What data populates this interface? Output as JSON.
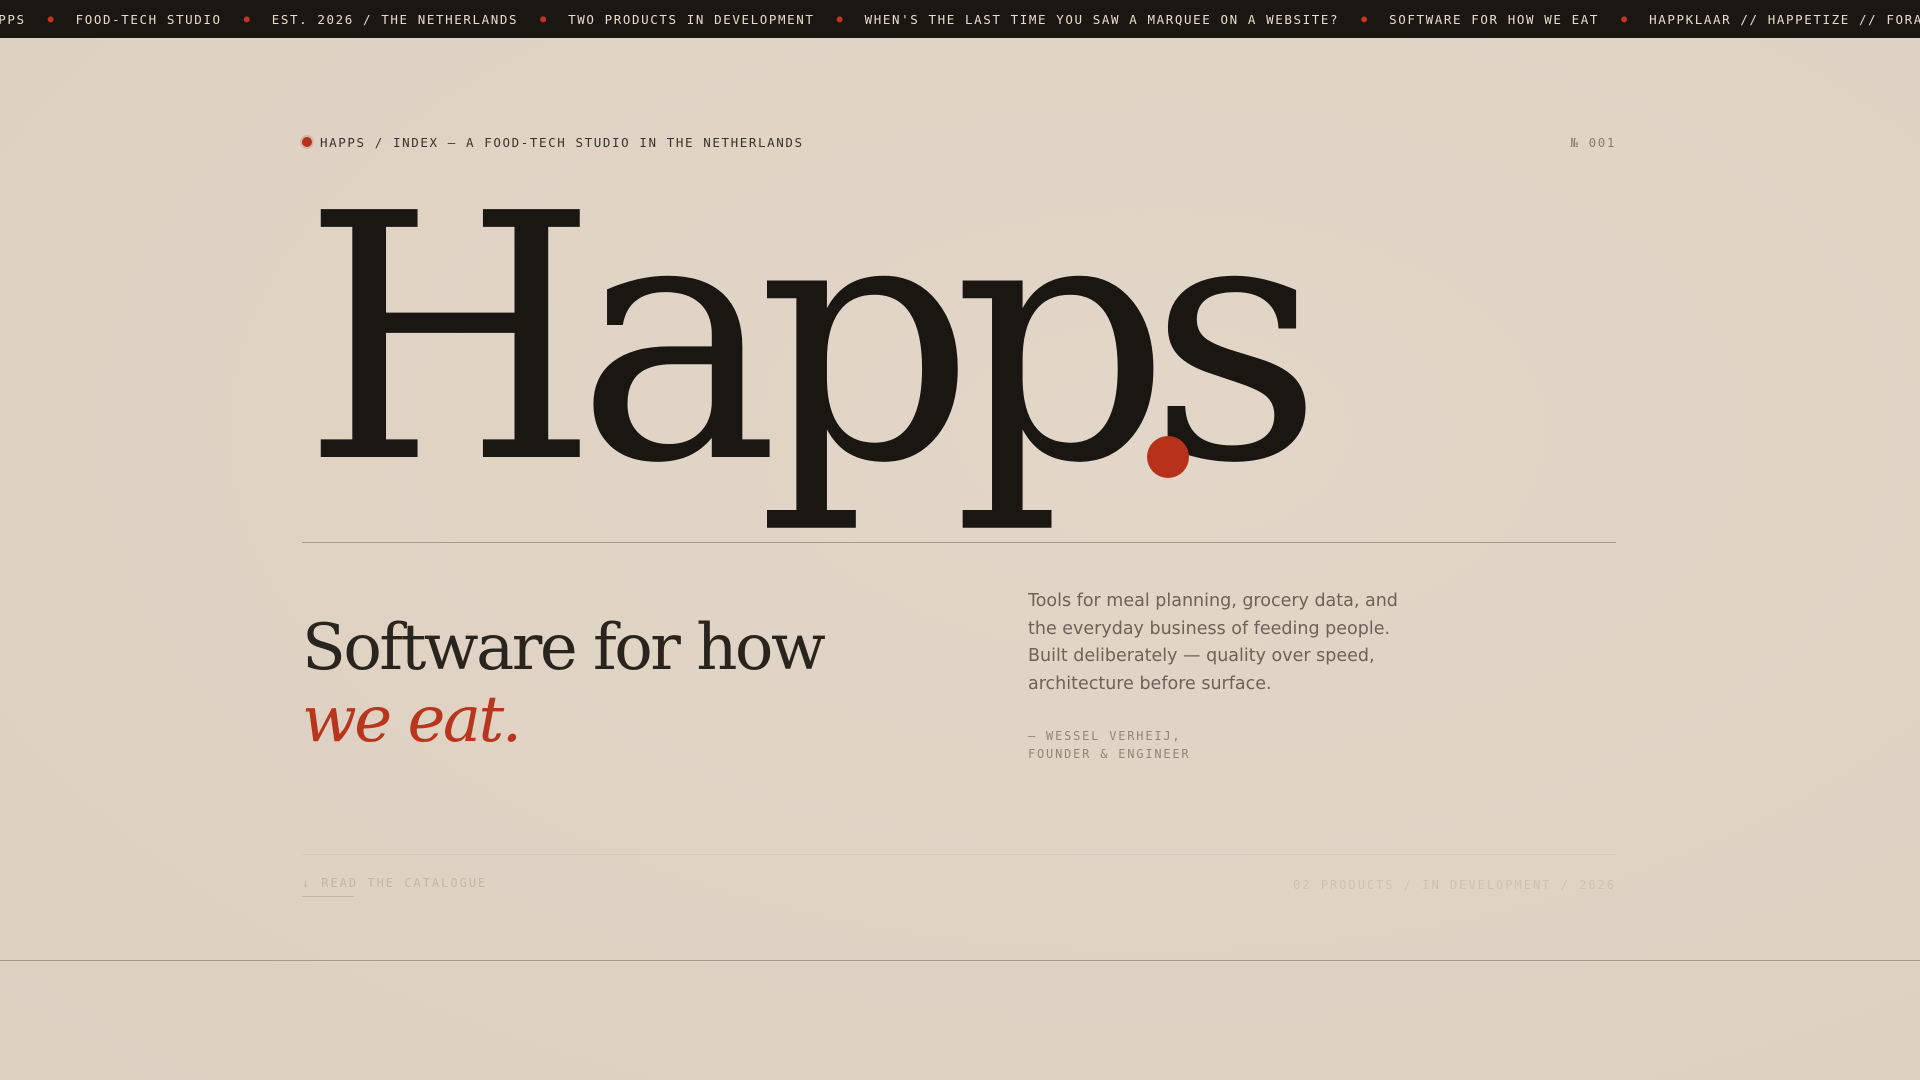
{
  "marquee": {
    "items": [
      "HAPPS",
      "FOOD-TECH STUDIO",
      "EST. 2026 / THE NETHERLANDS",
      "TWO PRODUCTS IN DEVELOPMENT",
      "WHEN'S THE LAST TIME YOU SAW A MARQUEE ON A WEBSITE?",
      "SOFTWARE FOR HOW WE EAT",
      "HAPPKLAAR // HAPPETIZE // FORAGER.FARM API"
    ],
    "separator": "●"
  },
  "header": {
    "breadcrumb": "HAPPS / INDEX — A FOOD-TECH STUDIO IN THE NETHERLANDS",
    "issue": "№ 001"
  },
  "hero": {
    "wordmark": "Happs",
    "accent_color": "#b8321a"
  },
  "tagline": {
    "line1": "Software for how",
    "line2": "we eat."
  },
  "description": {
    "text": "Tools for meal planning, grocery data, and the everyday business of feeding people. Built deliberately — quality over speed, architecture before surface.",
    "byline_line1": "— WESSEL VERHEIJ,",
    "byline_line2": "FOUNDER & ENGINEER"
  },
  "footer": {
    "read_arrow": "↓",
    "read_label": "READ THE CATALOGUE",
    "status": "02 PRODUCTS / IN DEVELOPMENT / 2026"
  },
  "colors": {
    "background": "#e0d4c6",
    "ink": "#1a1612",
    "accent": "#b8321a"
  }
}
